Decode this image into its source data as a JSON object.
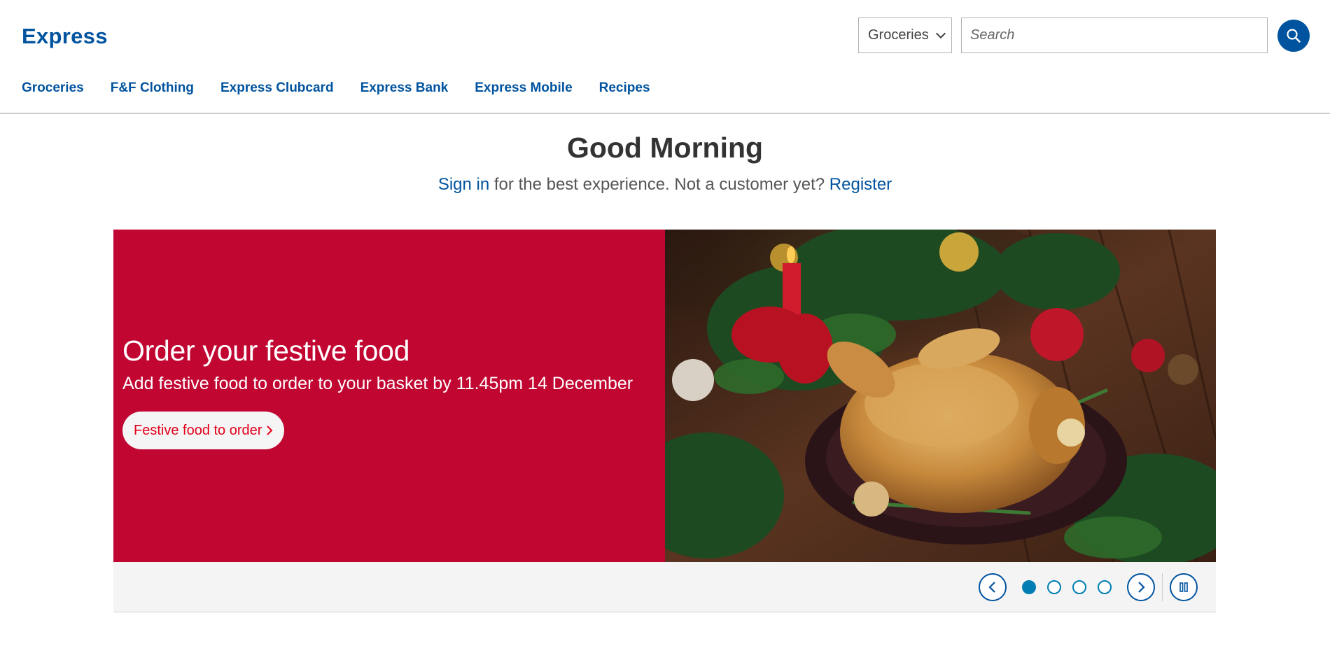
{
  "brand": {
    "logo_text": "Express",
    "primary": "#00539f",
    "banner_red": "#c10632"
  },
  "search": {
    "category": "Groceries",
    "placeholder": "Search"
  },
  "nav": [
    "Groceries",
    "F&F Clothing",
    "Express Clubcard",
    "Express Bank",
    "Express Mobile",
    "Recipes"
  ],
  "greeting": {
    "title": "Good Morning",
    "sign_in": "Sign in",
    "middle": " for the best experience. Not a customer yet? ",
    "register": "Register"
  },
  "banner": {
    "title": "Order your festive food",
    "subtitle": "Add festive food to order to your basket by 11.45pm 14 December",
    "button": "Festive food to order"
  },
  "carousel": {
    "slides": 4,
    "active_slide": 1
  },
  "icons": [
    "search-icon",
    "chevron-down-icon",
    "chevron-left-icon",
    "chevron-right-icon",
    "pause-icon"
  ]
}
